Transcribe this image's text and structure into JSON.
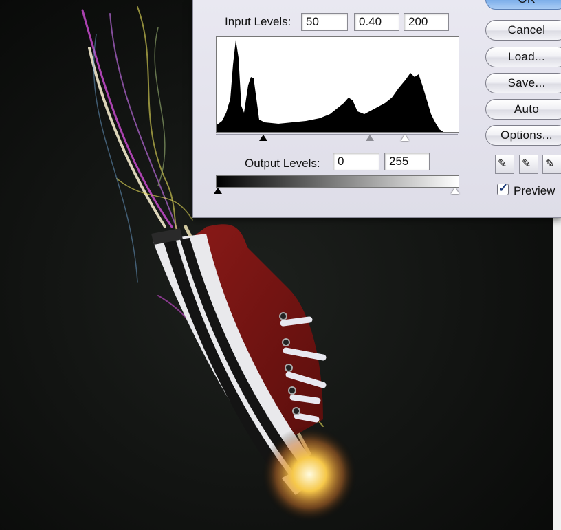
{
  "dialog": {
    "input_levels_label": "Input Levels:",
    "input_black": "50",
    "input_gamma": "0.40",
    "input_white": "200",
    "output_levels_label": "Output Levels:",
    "output_black": "0",
    "output_white": "255",
    "buttons": {
      "ok": "OK",
      "cancel": "Cancel",
      "load": "Load...",
      "save": "Save...",
      "auto": "Auto",
      "options": "Options..."
    },
    "preview_label": "Preview",
    "preview_checked": true,
    "eyedroppers": [
      "black-point-eyedropper-icon",
      "gray-point-eyedropper-icon",
      "white-point-eyedropper-icon"
    ]
  },
  "colors": {
    "background": "#0c0d0c",
    "shoe_canvas": "#7a1414",
    "dialog_bg": "#e4e3ed",
    "ok_button": "#7eafea",
    "light_streak_pink": "#d24fd8",
    "light_streak_yellow": "#e8e05a"
  }
}
